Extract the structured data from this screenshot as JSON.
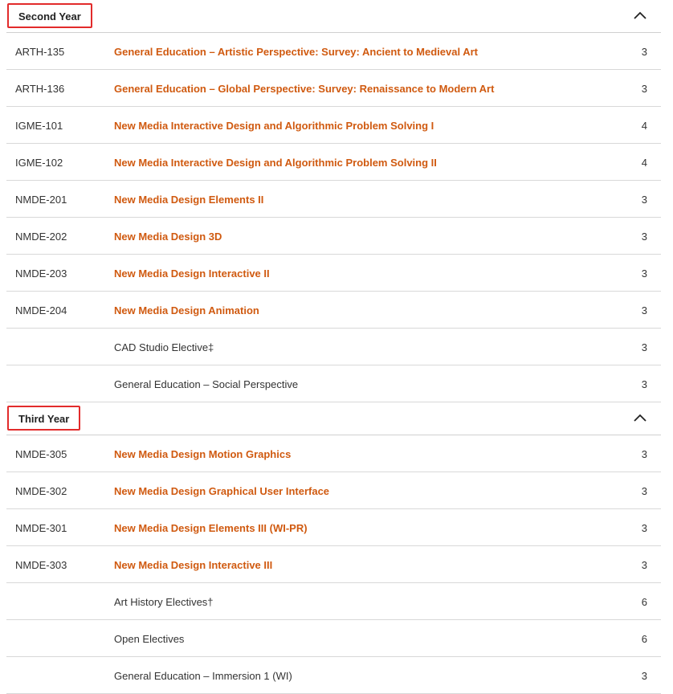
{
  "sections": [
    {
      "title": "Second Year",
      "rows": [
        {
          "code": "ARTH-135",
          "title": "General Education – Artistic Perspective: Survey: Ancient to Medieval Art",
          "credits": "3",
          "link": true
        },
        {
          "code": "ARTH-136",
          "title": "General Education – Global Perspective: Survey: Renaissance to Modern Art",
          "credits": "3",
          "link": true
        },
        {
          "code": "IGME-101",
          "title": "New Media Interactive Design and Algorithmic Problem Solving I",
          "credits": "4",
          "link": true
        },
        {
          "code": "IGME-102",
          "title": "New Media Interactive Design and Algorithmic Problem Solving II",
          "credits": "4",
          "link": true
        },
        {
          "code": "NMDE-201",
          "title": "New Media Design Elements II",
          "credits": "3",
          "link": true
        },
        {
          "code": "NMDE-202",
          "title": "New Media Design 3D",
          "credits": "3",
          "link": true
        },
        {
          "code": "NMDE-203",
          "title": "New Media Design Interactive II",
          "credits": "3",
          "link": true
        },
        {
          "code": "NMDE-204",
          "title": "New Media Design Animation",
          "credits": "3",
          "link": true
        },
        {
          "code": "",
          "title": "CAD Studio Elective‡",
          "credits": "3",
          "link": false
        },
        {
          "code": "",
          "title": "General Education – Social Perspective",
          "credits": "3",
          "link": false
        }
      ]
    },
    {
      "title": "Third Year",
      "rows": [
        {
          "code": "NMDE-305",
          "title": "New Media Design Motion Graphics",
          "credits": "3",
          "link": true
        },
        {
          "code": "NMDE-302",
          "title": "New Media Design Graphical User Interface",
          "credits": "3",
          "link": true
        },
        {
          "code": "NMDE-301",
          "title": "New Media Design Elements III (WI-PR)",
          "credits": "3",
          "link": true
        },
        {
          "code": "NMDE-303",
          "title": "New Media Design Interactive III",
          "credits": "3",
          "link": true
        },
        {
          "code": "",
          "title": "Art History Electives†",
          "credits": "6",
          "link": false
        },
        {
          "code": "",
          "title": "Open Electives",
          "credits": "6",
          "link": false
        },
        {
          "code": "",
          "title": "General Education – Immersion 1 (WI)",
          "credits": "3",
          "link": false
        }
      ]
    }
  ],
  "icons": {
    "collapse": "chevron-up-icon"
  },
  "colors": {
    "link": "#d05a10",
    "highlight_border": "#e22b2b",
    "divider": "#d8d8d8"
  }
}
